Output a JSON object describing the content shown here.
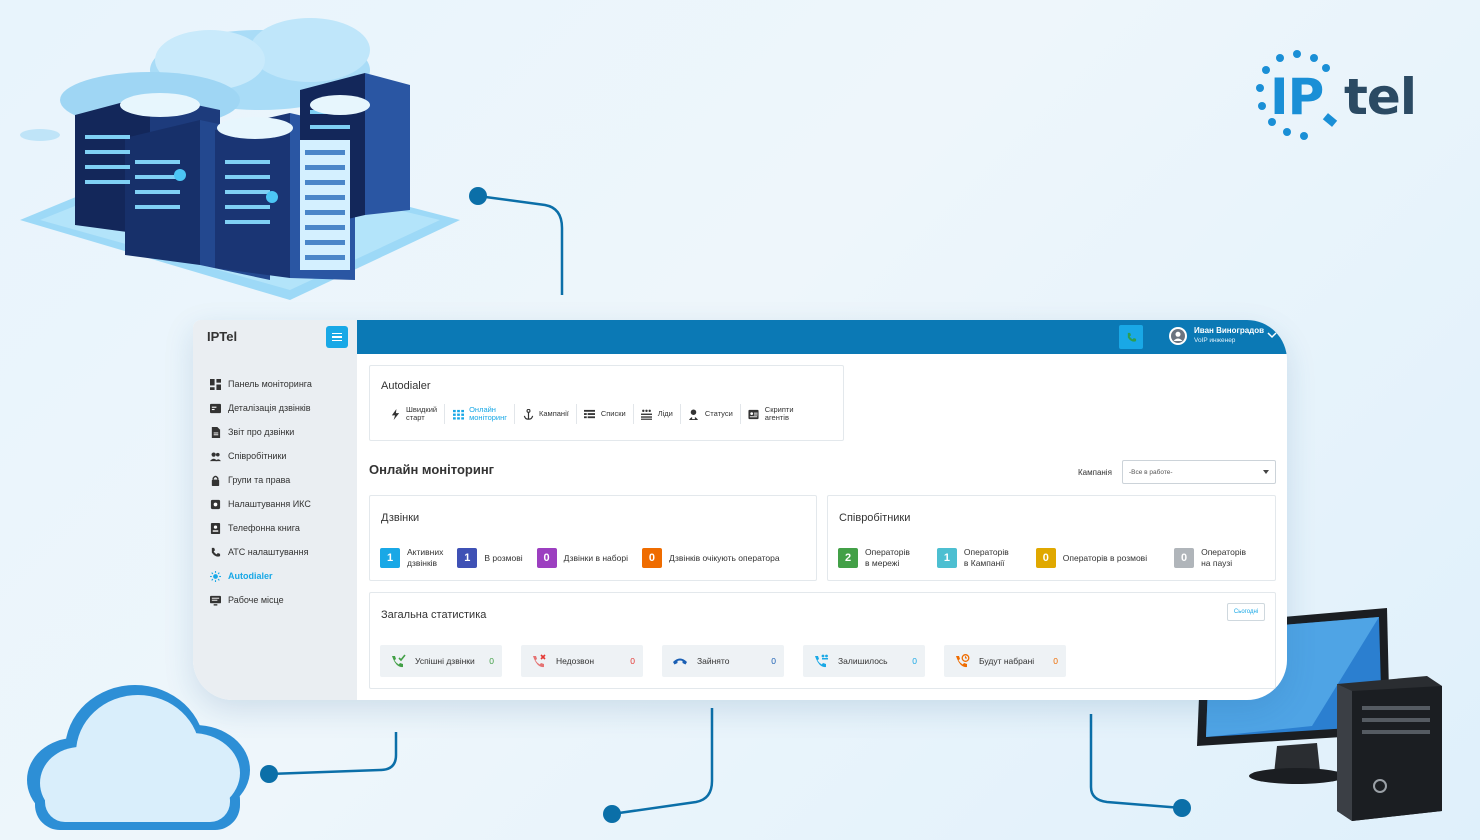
{
  "app": {
    "brand": "IPTel"
  },
  "sidebar": {
    "items": [
      {
        "label": "Панель моніторинга",
        "icon": "dashboard-icon"
      },
      {
        "label": "Деталізація дзвінків",
        "icon": "call-detail-icon"
      },
      {
        "label": "Звіт про дзвінки",
        "icon": "report-icon"
      },
      {
        "label": "Співробітники",
        "icon": "users-icon"
      },
      {
        "label": "Групи та права",
        "icon": "lock-icon"
      },
      {
        "label": "Налаштування ИКС",
        "icon": "gear-icon"
      },
      {
        "label": "Телефонна книга",
        "icon": "phonebook-icon"
      },
      {
        "label": "АТС налаштування",
        "icon": "phone-icon"
      },
      {
        "label": "Autodialer",
        "icon": "autodialer-icon",
        "active": true
      },
      {
        "label": "Рабоче місце",
        "icon": "workplace-icon"
      }
    ]
  },
  "topbar": {
    "user_name": "Иван Виноградов",
    "user_role": "VoIP инженер"
  },
  "autodialer": {
    "title": "Autodialer",
    "tabs": [
      {
        "label": "Швидкий старт",
        "line1": "Швидкий",
        "line2": "старт",
        "icon": "lightning-icon"
      },
      {
        "label": "Онлайн моніторинг",
        "line1": "Онлайн",
        "line2": "моніторинг",
        "icon": "grid-icon",
        "active": true
      },
      {
        "label": "Кампанії",
        "line1": "Кампанії",
        "line2": "",
        "icon": "anchor-icon"
      },
      {
        "label": "Списки",
        "line1": "Списки",
        "line2": "",
        "icon": "table-icon"
      },
      {
        "label": "Ліди",
        "line1": "Ліди",
        "line2": "",
        "icon": "leads-icon"
      },
      {
        "label": "Статуси",
        "line1": "Статуси",
        "line2": "",
        "icon": "status-icon"
      },
      {
        "label": "Скрипти агентів",
        "line1": "Скрипти",
        "line2": "агентів",
        "icon": "script-icon"
      }
    ]
  },
  "page": {
    "title": "Онлайн моніторинг",
    "campaign_label": "Кампанія",
    "campaign_value": "-Все в работе-"
  },
  "calls": {
    "title": "Дзвінки",
    "stats": [
      {
        "value": "1",
        "line1": "Активних",
        "line2": "дзвінків",
        "color": "#19a8e6"
      },
      {
        "value": "1",
        "line1": "В розмові",
        "line2": "",
        "color": "#3f51b5"
      },
      {
        "value": "0",
        "line1": "Дзвінки в наборі",
        "line2": "",
        "color": "#9c3fc0"
      },
      {
        "value": "0",
        "line1": "Дзвінків очікують оператора",
        "line2": "",
        "color": "#ef6c00"
      }
    ]
  },
  "employees": {
    "title": "Співробітники",
    "stats": [
      {
        "value": "2",
        "line1": "Операторів",
        "line2": "в мережі",
        "color": "#43a047"
      },
      {
        "value": "1",
        "line1": "Операторів",
        "line2": "в Кампанії",
        "color": "#4dbfd1"
      },
      {
        "value": "0",
        "line1": "Операторів в розмові",
        "line2": "",
        "color": "#e0a800"
      },
      {
        "value": "0",
        "line1": "Операторів",
        "line2": "на паузі",
        "color": "#b0b5ba"
      }
    ]
  },
  "general": {
    "title": "Загальна статистика",
    "today": "Сьогодні",
    "stats": [
      {
        "label": "Успішні дзвінки",
        "value": "0",
        "color": "#43a047",
        "icon": "phone-check-icon"
      },
      {
        "label": "Недозвон",
        "value": "0",
        "color": "#e53935",
        "icon": "phone-missed-icon"
      },
      {
        "label": "Зайнято",
        "value": "0",
        "color": "#1a5fb4",
        "icon": "phone-hangup-icon"
      },
      {
        "label": "Залишилось",
        "value": "0",
        "color": "#19a8e6",
        "icon": "phone-queue-icon"
      },
      {
        "label": "Будут набрані",
        "value": "0",
        "color": "#ef6c00",
        "icon": "phone-scheduled-icon"
      }
    ]
  },
  "logo": {
    "ip": "IP",
    "tel": "tel"
  }
}
